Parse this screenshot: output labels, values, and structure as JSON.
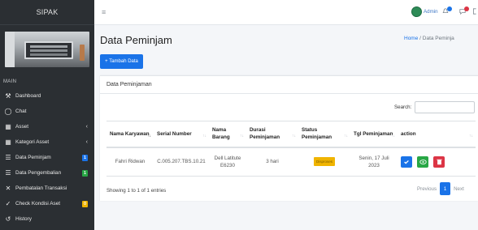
{
  "brand": "SIPAK",
  "sidebar": {
    "section_label": "MAIN",
    "items": [
      {
        "label": "Dashboard",
        "icon": "⚒"
      },
      {
        "label": "Chat",
        "icon": "◯"
      },
      {
        "label": "Asset",
        "icon": "▦",
        "arrow": "‹"
      },
      {
        "label": "Kategori Asset",
        "icon": "▦",
        "arrow": "‹"
      },
      {
        "label": "Data Peminjam",
        "icon": "☰",
        "badge": "1",
        "badge_color": "#1a73e8"
      },
      {
        "label": "Data Pengembalian",
        "icon": "☰",
        "badge": "1",
        "badge_color": "#28a745"
      },
      {
        "label": "Pembatalan Transaksi",
        "icon": "✕"
      },
      {
        "label": "Check Kondisi Aset",
        "icon": "✓",
        "badge": "0",
        "badge_color": "#f0b400"
      },
      {
        "label": "History",
        "icon": "↺"
      }
    ]
  },
  "topbar": {
    "menu_icon": "≡",
    "user_name": "Admin"
  },
  "page": {
    "title": "Data Peminjam",
    "breadcrumb_home": "Home",
    "breadcrumb_sep": " / ",
    "breadcrumb_current": "Data Peminja",
    "add_button": "+ Tambah Data"
  },
  "card": {
    "header": "Data Peminjaman",
    "search_label": "Search:",
    "columns": [
      {
        "label": "Nama Karyawan",
        "sort": "↑↓",
        "active": true
      },
      {
        "label": "Serial Number",
        "sort": "↑↓"
      },
      {
        "label": "Nama Barang",
        "sort": "↑↓"
      },
      {
        "label": "Durasi Peminjaman",
        "sort": "↑↓"
      },
      {
        "label": "Status Peminjaman",
        "sort": "↑↓"
      },
      {
        "label": "Tgl Peminjaman",
        "sort": "↑↓"
      },
      {
        "label": "action",
        "sort": ""
      },
      {
        "label": "",
        "sort": "↑↓"
      }
    ],
    "rows": [
      {
        "nama_karyawan": "Fahri Ridwan",
        "serial_number": "C.005.207.TBS.10.21",
        "nama_barang": "Dell Latitute E6230",
        "durasi": "3 hari",
        "status": "Disproses",
        "tgl": "Senin, 17 Juli 2023"
      }
    ],
    "showing": "Showing 1 to 1 of 1 entries",
    "pager": {
      "previous": "Previous",
      "current": "1",
      "next": "Next"
    }
  },
  "colors": {
    "sidebar_bg": "#2b2f33",
    "primary": "#1a73e8",
    "status_pill": "#f0b400",
    "btn_edit": "#1a73e8",
    "btn_view": "#28a745",
    "btn_delete": "#dc3545"
  }
}
